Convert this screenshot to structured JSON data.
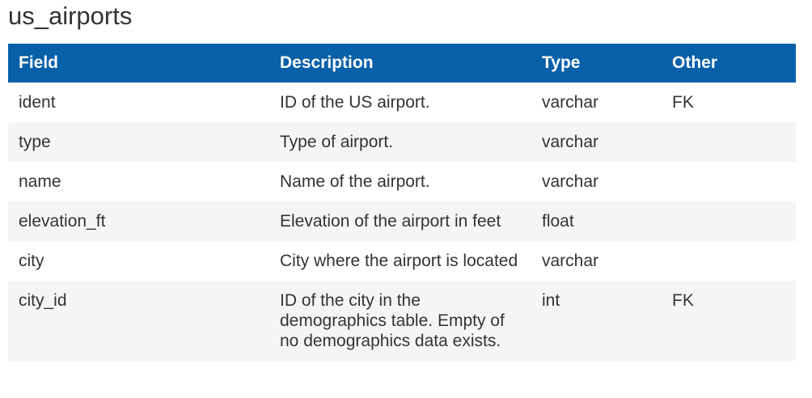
{
  "page": {
    "title": "us_airports"
  },
  "table": {
    "headers": {
      "field": "Field",
      "description": "Description",
      "type": "Type",
      "other": "Other"
    },
    "rows": [
      {
        "field": "ident",
        "description": "ID of the US airport.",
        "type": "varchar",
        "other": "FK"
      },
      {
        "field": "type",
        "description": "Type of airport.",
        "type": "varchar",
        "other": ""
      },
      {
        "field": "name",
        "description": "Name of the airport.",
        "type": "varchar",
        "other": ""
      },
      {
        "field": "elevation_ft",
        "description": "Elevation of the airport in feet",
        "type": "float",
        "other": ""
      },
      {
        "field": "city",
        "description": "City where the airport is located",
        "type": "varchar",
        "other": ""
      },
      {
        "field": "city_id",
        "description": "ID of the city in the demographics table. Empty of no demographics data exists.",
        "type": "int",
        "other": "FK"
      }
    ]
  },
  "colors": {
    "header_bg": "#0860a8",
    "header_text": "#ffffff",
    "stripe_bg": "#f5f5f5",
    "body_text": "#333333"
  }
}
